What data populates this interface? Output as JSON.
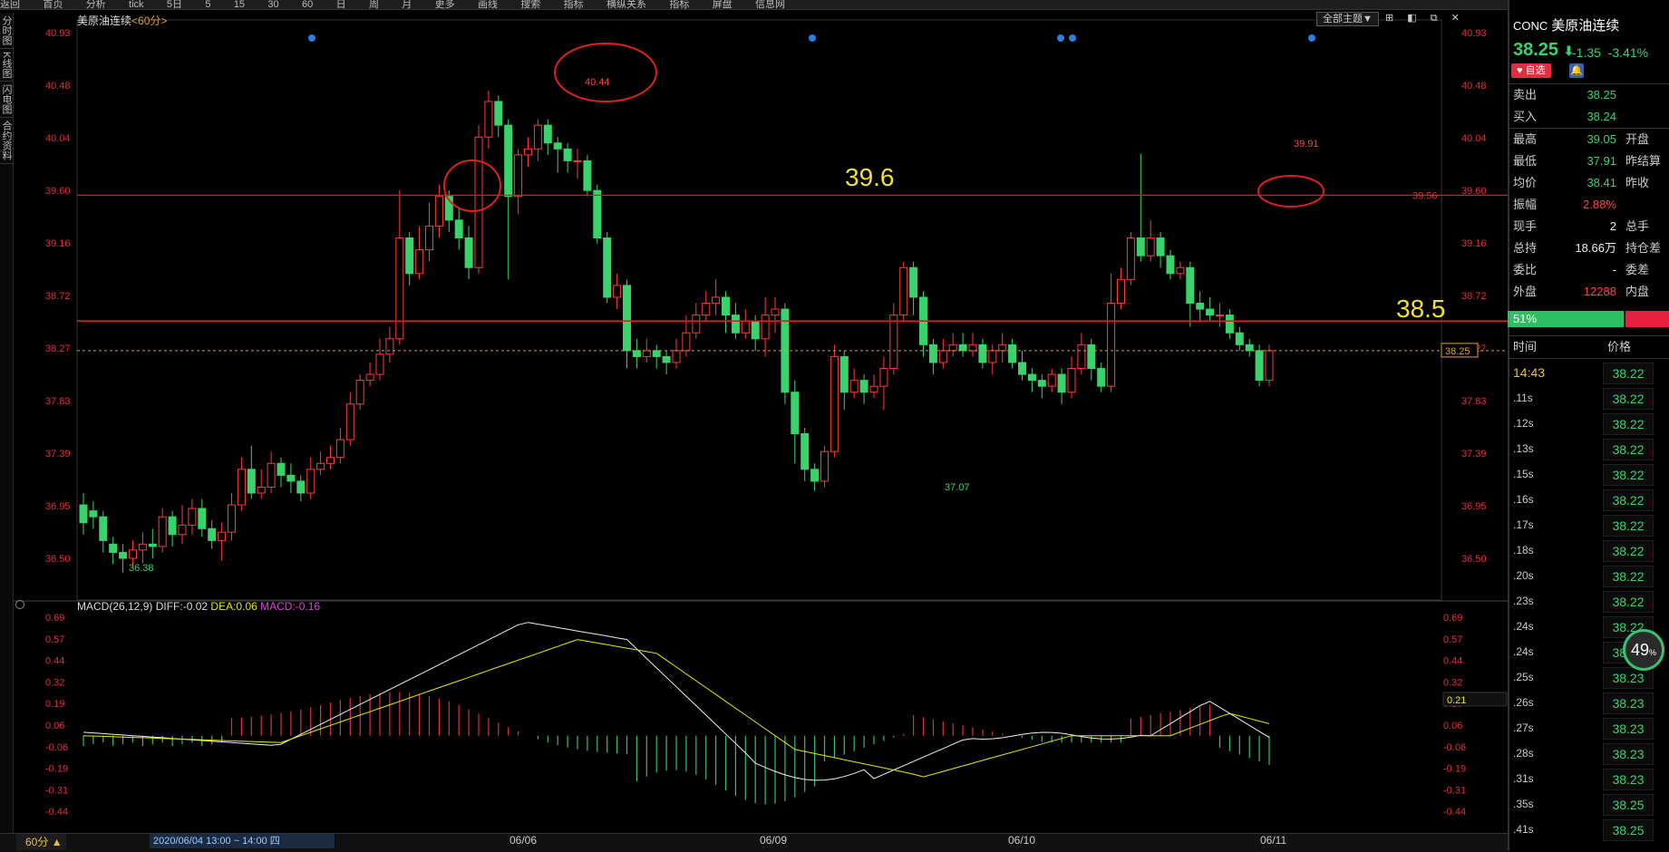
{
  "toolbar": {
    "items": [
      "返回",
      "首页",
      "分析",
      "tick",
      "5日",
      "5",
      "15",
      "30",
      "60",
      "日",
      "周",
      "月",
      "更多",
      "画线",
      "搜索",
      "指标",
      "横纵关系",
      "指标",
      "屏盘",
      "信息网"
    ]
  },
  "left_tabs": [
    "分时图",
    "K线图",
    "闪电图",
    "合约资料"
  ],
  "chart_header": {
    "name": "美原油连续",
    "period": "<60分>"
  },
  "theme_button": "全部主题▼",
  "window_icons": "⊞ ◧ ⧉ ✕",
  "main_chart": {
    "y_ticks": [
      "40.93",
      "40.48",
      "40.04",
      "39.60",
      "39.16",
      "38.72",
      "38.27",
      "37.83",
      "37.39",
      "36.95",
      "36.50"
    ],
    "current_price_label": "38.25",
    "level_label_right": "39.56",
    "high_label": "40.44",
    "low_label": "37.07",
    "first_low_label": "36.38",
    "right_high_label": "39.91",
    "annotation_upper": "39.6",
    "annotation_lower": "38.5"
  },
  "macd": {
    "title": "MACD(26,12,9)",
    "diff": "DIFF:-0.02",
    "dea": "DEA:0.06",
    "macd": "MACD:-0.16",
    "y_ticks": [
      "0.69",
      "0.57",
      "0.44",
      "0.32",
      "0.19",
      "0.06",
      "-0.06",
      "-0.19",
      "-0.31",
      "-0.44"
    ],
    "right_marker": "0.21"
  },
  "bottom": {
    "period": "60分",
    "period_arrow": "▲",
    "time_range": "2020/06/04 13:00 ~ 14:00 四",
    "dates": [
      "06/06",
      "06/09",
      "06/10",
      "06/11"
    ]
  },
  "quote": {
    "code": "CONC",
    "name": "美原油连续",
    "price": "38.25",
    "arrow": "⬇",
    "change": "-1.35",
    "change_pct": "-3.41%",
    "watch_button": "♥ 自选",
    "bell": "🔔",
    "rows": [
      {
        "l": "卖出",
        "v": "38.25",
        "c": "g",
        "r": ""
      },
      {
        "l": "买入",
        "v": "38.24",
        "c": "g",
        "r": ""
      },
      {
        "l": "最高",
        "v": "39.05",
        "c": "g",
        "r": "开盘"
      },
      {
        "l": "最低",
        "v": "37.91",
        "c": "g",
        "r": "昨结算"
      },
      {
        "l": "均价",
        "v": "38.41",
        "c": "g",
        "r": "昨收"
      },
      {
        "l": "振幅",
        "v": "2.88%",
        "c": "rd",
        "r": ""
      },
      {
        "l": "现手",
        "v": "2",
        "c": "wt",
        "r": "总手"
      },
      {
        "l": "总持",
        "v": "18.66万",
        "c": "wt",
        "r": "持仓差"
      },
      {
        "l": "委比",
        "v": "-",
        "c": "wt",
        "r": "委差"
      },
      {
        "l": "外盘",
        "v": "12288",
        "c": "rd",
        "r": "内盘"
      }
    ],
    "ratio": "51%",
    "tick_header": {
      "time": "时间",
      "price": "价格"
    },
    "ticks": [
      {
        "t": "14:43",
        "p": "38.22"
      },
      {
        "t": ".11s",
        "p": "38.22"
      },
      {
        "t": ".12s",
        "p": "38.22"
      },
      {
        "t": ".13s",
        "p": "38.22"
      },
      {
        "t": ".15s",
        "p": "38.22"
      },
      {
        "t": ".16s",
        "p": "38.22"
      },
      {
        "t": ".17s",
        "p": "38.22"
      },
      {
        "t": ".18s",
        "p": "38.22"
      },
      {
        "t": ".20s",
        "p": "38.22"
      },
      {
        "t": ".23s",
        "p": "38.22"
      },
      {
        "t": ".24s",
        "p": "38.22"
      },
      {
        "t": ".24s",
        "p": "38.22"
      },
      {
        "t": ".25s",
        "p": "38.23"
      },
      {
        "t": ".26s",
        "p": "38.23"
      },
      {
        "t": ".27s",
        "p": "38.23"
      },
      {
        "t": ".28s",
        "p": "38.23"
      },
      {
        "t": ".31s",
        "p": "38.23"
      },
      {
        "t": ".35s",
        "p": "38.25"
      },
      {
        "t": ".41s",
        "p": "38.25"
      }
    ],
    "gauge": "49",
    "gauge_unit": "%"
  },
  "colors": {
    "up": "#ff3b3b",
    "down": "#3ad36b",
    "axis": "#e0303e",
    "line_red": "#d02020",
    "annotation": "#f0e030"
  }
}
